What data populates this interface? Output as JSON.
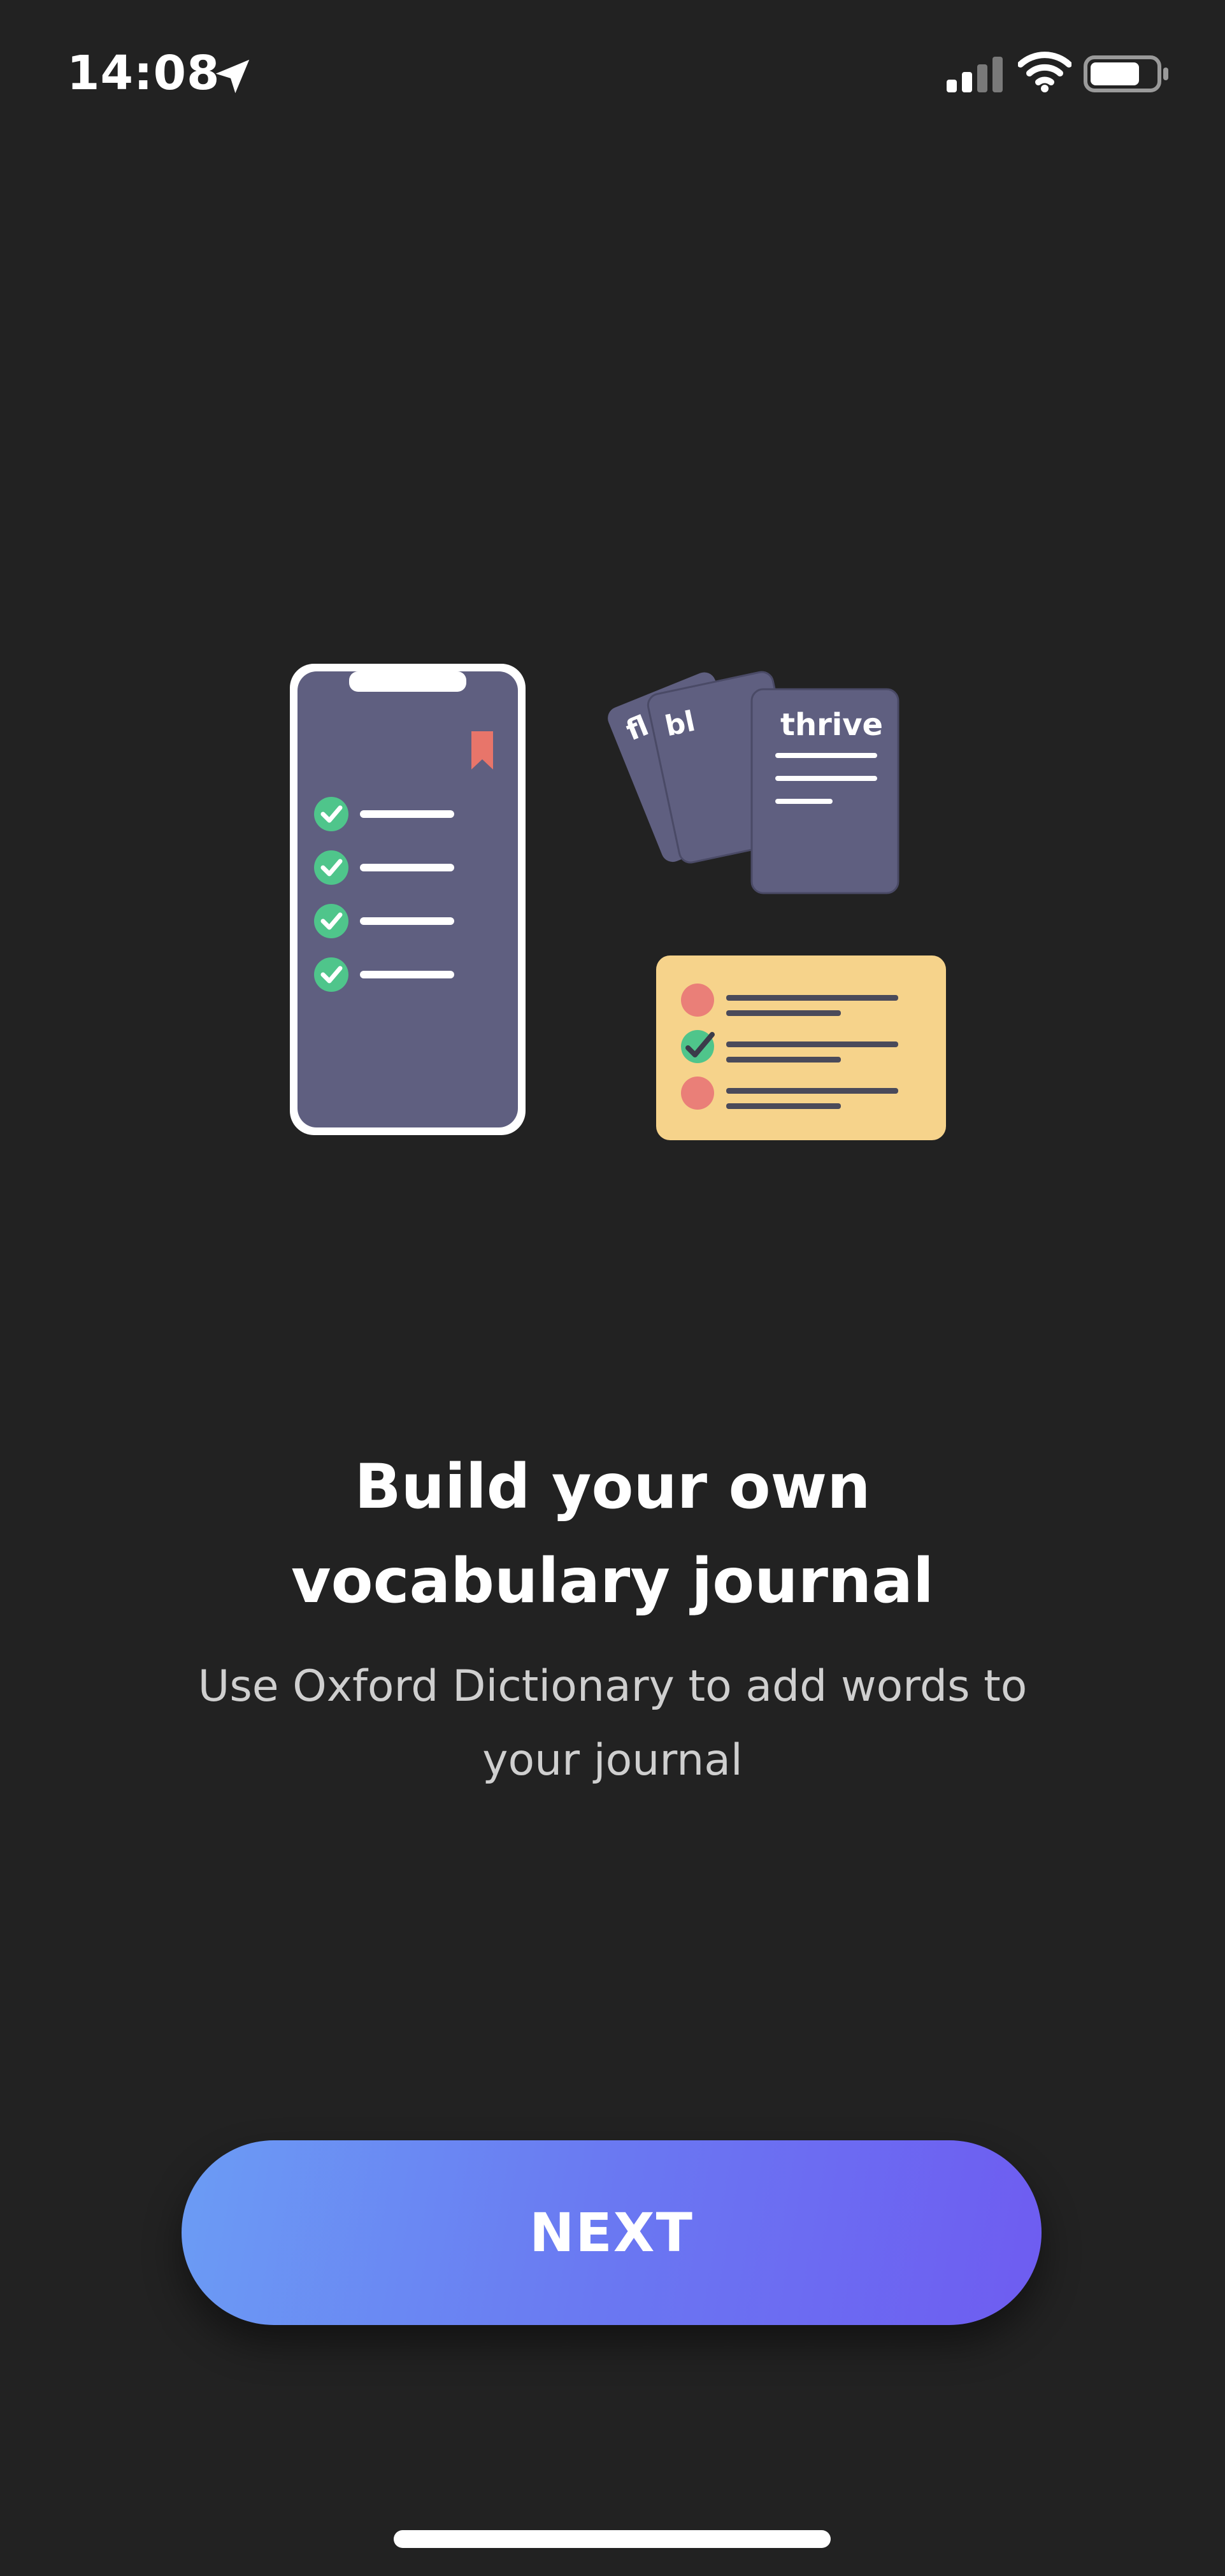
{
  "status_bar": {
    "time": "14:08",
    "icons": [
      "location-arrow-icon",
      "cellular-signal-icon",
      "wifi-icon",
      "battery-icon"
    ]
  },
  "illustration": {
    "card_words": [
      "fl",
      "bl",
      "thrive"
    ]
  },
  "onboarding": {
    "title_line1": "Build your own",
    "title_line2": "vocabulary journal",
    "subtitle_line1": "Use Oxford Dictionary to add words to",
    "subtitle_line2": "your journal"
  },
  "next_button": {
    "label": "NEXT"
  },
  "colors": {
    "background": "#222222",
    "phone_body": "#5f5f80",
    "check_green": "#4fc58b",
    "bookmark_red": "#e8756a",
    "quiz_card": "#f6d38b",
    "quiz_dot": "#ea7f78",
    "button_start": "#6b9cf4",
    "button_end": "#6e5cf1"
  }
}
